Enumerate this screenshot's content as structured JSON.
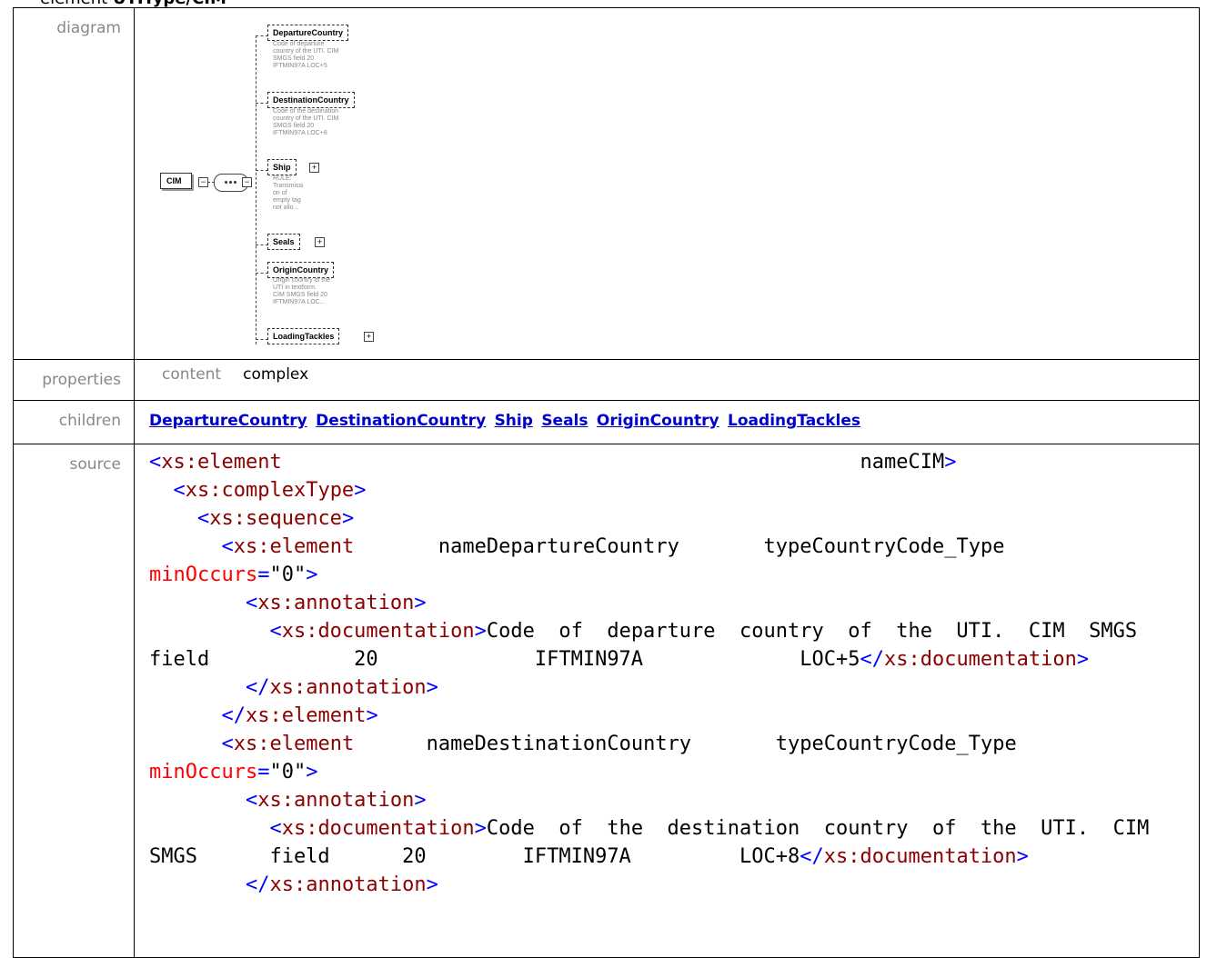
{
  "page": {
    "title_prefix": "element ",
    "title_bold": "UTIType/CIM"
  },
  "rows": {
    "diagram": "diagram",
    "properties": "properties",
    "children": "children",
    "source": "source"
  },
  "diagram": {
    "root": "CIM",
    "items": [
      {
        "name": "DepartureCountry",
        "note": [
          "Code of departure",
          "country of the UTI. CIM",
          "SMGS field 20",
          "IFTMIN97A LOC+5"
        ]
      },
      {
        "name": "DestinationCountry",
        "note": [
          "Code of the destination",
          "country of the UTI. CIM",
          "SMGS field 20",
          "IFTMIN97A LOC+8"
        ]
      },
      {
        "name": "Ship",
        "note": [
          "RULE:",
          "Transmissi",
          "on of",
          "empty tag",
          "not allo..."
        ]
      },
      {
        "name": "Seals",
        "note": []
      },
      {
        "name": "OriginCountry",
        "note": [
          "Origin country of the",
          "UTI in textform.",
          "CIM SMGS field 20",
          "IFTMIN97A LOC..."
        ]
      },
      {
        "name": "LoadingTackles",
        "note": []
      }
    ]
  },
  "properties": {
    "key": "content",
    "value": "complex"
  },
  "children": [
    "DepartureCountry",
    "DestinationCountry",
    "Ship",
    "Seals",
    "OriginCountry",
    "LoadingTackles"
  ],
  "source_lines": [
    "<xs:element                                                name=\"CIM\">",
    "  <xs:complexType>",
    "    <xs:sequence>",
    "      <xs:element       name=\"DepartureCountry\"       type=\"CountryCode_Type\"",
    "minOccurs=\"0\">",
    "        <xs:annotation>",
    "          <xs:documentation>Code  of  departure  country  of  the  UTI.  CIM  SMGS",
    "field            20             IFTMIN97A             LOC+5</xs:documentation>",
    "        </xs:annotation>",
    "      </xs:element>",
    "      <xs:element      name=\"DestinationCountry\"       type=\"CountryCode_Type\"",
    "minOccurs=\"0\">",
    "        <xs:annotation>",
    "          <xs:documentation>Code  of  the  destination  country  of  the  UTI.  CIM",
    "SMGS      field      20        IFTMIN97A         LOC+8</xs:documentation>",
    "        </xs:annotation>"
  ]
}
